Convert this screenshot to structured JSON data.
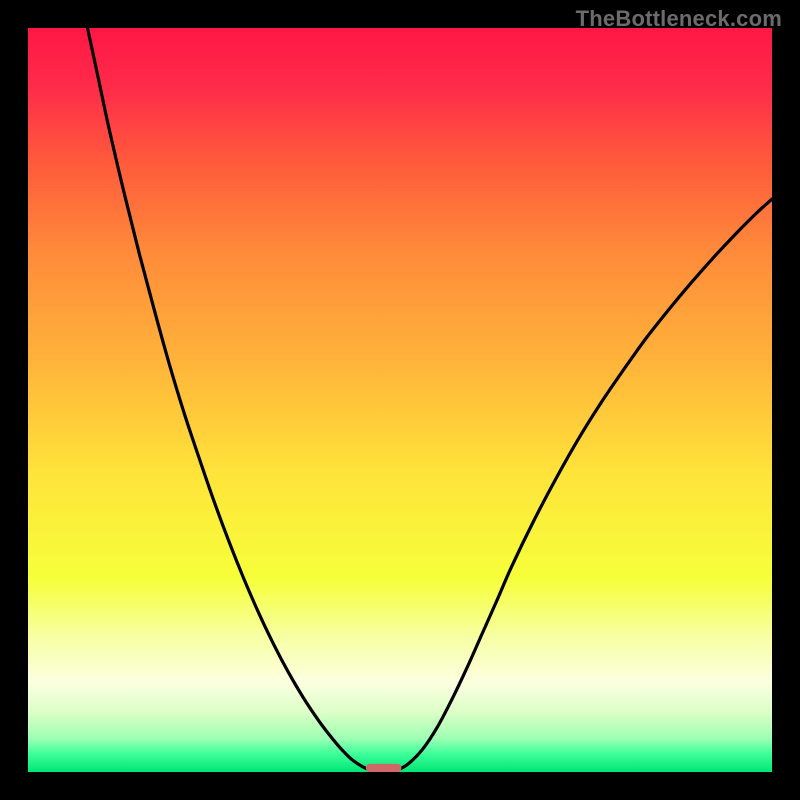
{
  "watermark": "TheBottleneck.com",
  "chart_data": {
    "type": "line",
    "title": "",
    "xlabel": "",
    "ylabel": "",
    "xlim": [
      0,
      100
    ],
    "ylim": [
      0,
      100
    ],
    "gradient_stops": [
      {
        "pct": 0.0,
        "color": "#ff1744"
      },
      {
        "pct": 0.08,
        "color": "#ff2b4a"
      },
      {
        "pct": 0.18,
        "color": "#ff5a3b"
      },
      {
        "pct": 0.3,
        "color": "#ff8a3a"
      },
      {
        "pct": 0.45,
        "color": "#ffb43a"
      },
      {
        "pct": 0.6,
        "color": "#ffe43a"
      },
      {
        "pct": 0.74,
        "color": "#f6ff3a"
      },
      {
        "pct": 0.82,
        "color": "#f7ffa5"
      },
      {
        "pct": 0.88,
        "color": "#fbffe0"
      },
      {
        "pct": 0.92,
        "color": "#dcffc7"
      },
      {
        "pct": 0.955,
        "color": "#9dffb3"
      },
      {
        "pct": 0.975,
        "color": "#3fff9a"
      },
      {
        "pct": 1.0,
        "color": "#00e676"
      }
    ],
    "series": [
      {
        "name": "left-curve",
        "points": [
          {
            "x": 8.0,
            "y": 100.0
          },
          {
            "x": 9.5,
            "y": 93.0
          },
          {
            "x": 11.0,
            "y": 86.0
          },
          {
            "x": 13.0,
            "y": 77.5
          },
          {
            "x": 15.0,
            "y": 69.5
          },
          {
            "x": 17.0,
            "y": 62.0
          },
          {
            "x": 19.0,
            "y": 54.8
          },
          {
            "x": 21.0,
            "y": 48.2
          },
          {
            "x": 23.0,
            "y": 42.2
          },
          {
            "x": 25.0,
            "y": 36.4
          },
          {
            "x": 27.0,
            "y": 31.0
          },
          {
            "x": 29.0,
            "y": 26.0
          },
          {
            "x": 31.0,
            "y": 21.4
          },
          {
            "x": 33.0,
            "y": 17.2
          },
          {
            "x": 35.0,
            "y": 13.4
          },
          {
            "x": 37.0,
            "y": 10.0
          },
          {
            "x": 39.0,
            "y": 7.0
          },
          {
            "x": 40.5,
            "y": 5.0
          },
          {
            "x": 42.0,
            "y": 3.2
          },
          {
            "x": 43.5,
            "y": 1.7
          },
          {
            "x": 45.0,
            "y": 0.7
          },
          {
            "x": 46.2,
            "y": 0.2
          }
        ]
      },
      {
        "name": "right-curve",
        "points": [
          {
            "x": 49.5,
            "y": 0.2
          },
          {
            "x": 51.0,
            "y": 1.0
          },
          {
            "x": 53.0,
            "y": 3.0
          },
          {
            "x": 55.0,
            "y": 6.0
          },
          {
            "x": 57.0,
            "y": 9.8
          },
          {
            "x": 59.0,
            "y": 14.0
          },
          {
            "x": 61.0,
            "y": 18.5
          },
          {
            "x": 63.0,
            "y": 23.0
          },
          {
            "x": 65.0,
            "y": 27.6
          },
          {
            "x": 68.0,
            "y": 33.8
          },
          {
            "x": 71.0,
            "y": 39.5
          },
          {
            "x": 74.0,
            "y": 44.8
          },
          {
            "x": 77.0,
            "y": 49.6
          },
          {
            "x": 80.0,
            "y": 54.0
          },
          {
            "x": 83.0,
            "y": 58.2
          },
          {
            "x": 86.0,
            "y": 62.0
          },
          {
            "x": 89.0,
            "y": 65.6
          },
          {
            "x": 92.0,
            "y": 69.0
          },
          {
            "x": 95.0,
            "y": 72.2
          },
          {
            "x": 98.0,
            "y": 75.2
          },
          {
            "x": 100.0,
            "y": 77.0
          }
        ]
      }
    ],
    "marker": {
      "name": "optimal-marker",
      "color": "#d06868",
      "x_center": 47.8,
      "x_halfwidth": 2.4,
      "y": 0.0,
      "height": 1.1
    }
  }
}
